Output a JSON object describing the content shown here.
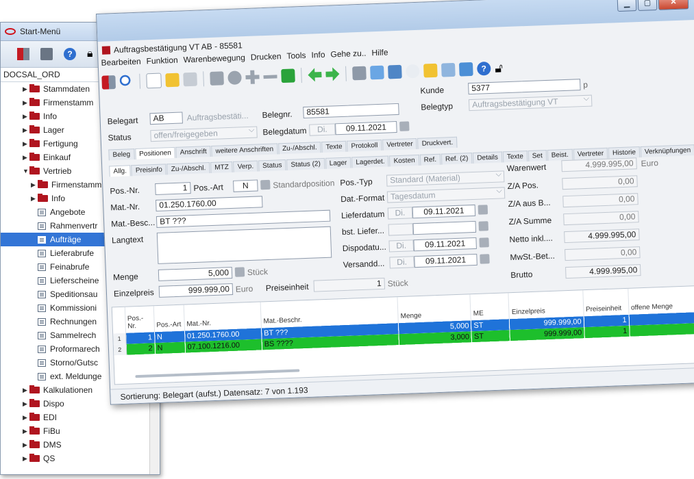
{
  "startmenu": {
    "title": "Start-Menü",
    "database": "DOCSAL_ORD",
    "tree": [
      {
        "label": "Stammdaten",
        "type": "folder",
        "level": 1,
        "expanded": false
      },
      {
        "label": "Firmenstamm",
        "type": "folder",
        "level": 1,
        "expanded": false
      },
      {
        "label": "Info",
        "type": "folder",
        "level": 1,
        "expanded": false
      },
      {
        "label": "Lager",
        "type": "folder",
        "level": 1,
        "expanded": false
      },
      {
        "label": "Fertigung",
        "type": "folder",
        "level": 1,
        "expanded": false
      },
      {
        "label": "Einkauf",
        "type": "folder",
        "level": 1,
        "expanded": false
      },
      {
        "label": "Vertrieb",
        "type": "folder",
        "level": 1,
        "expanded": true
      },
      {
        "label": "Firmenstamm",
        "type": "folder",
        "level": 2,
        "expanded": false
      },
      {
        "label": "Info",
        "type": "folder",
        "level": 2,
        "expanded": false
      },
      {
        "label": "Angebote",
        "type": "doc",
        "level": 2
      },
      {
        "label": "Rahmenvertr",
        "type": "doc",
        "level": 2
      },
      {
        "label": "Aufträge",
        "type": "doc",
        "level": 2,
        "selected": true
      },
      {
        "label": "Lieferabrufe",
        "type": "doc",
        "level": 2
      },
      {
        "label": "Feinabrufe",
        "type": "doc",
        "level": 2
      },
      {
        "label": "Lieferscheine",
        "type": "doc",
        "level": 2
      },
      {
        "label": "Speditionsau",
        "type": "doc",
        "level": 2
      },
      {
        "label": "Kommissioni",
        "type": "doc",
        "level": 2
      },
      {
        "label": "Rechnungen",
        "type": "doc",
        "level": 2
      },
      {
        "label": "Sammelrech",
        "type": "doc",
        "level": 2
      },
      {
        "label": "Proformarech",
        "type": "doc",
        "level": 2
      },
      {
        "label": "Storno/Gutsc",
        "type": "doc",
        "level": 2
      },
      {
        "label": "ext. Meldunge",
        "type": "doc",
        "level": 2
      },
      {
        "label": "Kalkulationen",
        "type": "folder",
        "level": 1,
        "expanded": false
      },
      {
        "label": "Dispo",
        "type": "folder",
        "level": 1,
        "expanded": false
      },
      {
        "label": "EDI",
        "type": "folder",
        "level": 1,
        "expanded": false
      },
      {
        "label": "FiBu",
        "type": "folder",
        "level": 1,
        "expanded": false
      },
      {
        "label": "DMS",
        "type": "folder",
        "level": 1,
        "expanded": false
      },
      {
        "label": "QS",
        "type": "folder",
        "level": 1,
        "expanded": false
      }
    ]
  },
  "window": {
    "title": "Auftragsbestätigung VT AB - 85581",
    "menu": [
      "Bearbeiten",
      "Funktion",
      "Warenbewegung",
      "Drucken",
      "Tools",
      "Info",
      "Gehe zu..",
      "Hilfe"
    ]
  },
  "header": {
    "kunde_label": "Kunde",
    "kunde_value": "5377",
    "kunde_suffix": "p",
    "belegart_label": "Belegart",
    "belegart_code": "AB",
    "belegart_text": "Auftragsbestäti...",
    "belegnr_label": "Belegnr.",
    "belegnr_value": "85581",
    "belegtyp_label": "Belegtyp",
    "belegtyp_value": "Auftragsbestätigung VT",
    "status_label": "Status",
    "status_value": "offen/freigegeben",
    "belegdatum_label": "Belegdatum",
    "belegdatum_day": "Di.",
    "belegdatum_value": "09.11.2021"
  },
  "tabs_main": [
    "Beleg",
    "Positionen",
    "Anschrift",
    "weitere Anschriften",
    "Zu-/Abschl.",
    "Texte",
    "Protokoll",
    "Vertreter",
    "Druckvert."
  ],
  "tabs_main_active": "Positionen",
  "tabs_pos": [
    "Allg.",
    "Preisinfo",
    "Zu-/Abschl.",
    "MTZ",
    "Verp.",
    "Status",
    "Status (2)",
    "Lager",
    "Lagerdet.",
    "Kosten",
    "Ref.",
    "Ref. (2)",
    "Details",
    "Texte",
    "Set",
    "Beist.",
    "Vertreter",
    "Historie",
    "Verknüpfungen"
  ],
  "tabs_pos_active": "Allg.",
  "position": {
    "posnr_label": "Pos.-Nr.",
    "posnr_value": "1",
    "posart_label": "Pos.-Art",
    "posart_value": "N",
    "posart_text": "Standardposition",
    "matnr_label": "Mat.-Nr.",
    "matnr_value": "01.250.1760.00",
    "matbesc_label": "Mat.-Besc...",
    "matbesc_value": "BT ???",
    "langtext_label": "Langtext",
    "menge_label": "Menge",
    "menge_value": "5,000",
    "menge_unit": "Stück",
    "einzelpreis_label": "Einzelpreis",
    "einzelpreis_value": "999.999,00",
    "einzelpreis_unit": "Euro",
    "preiseinheit_label": "Preiseinheit",
    "preiseinheit_value": "1",
    "preiseinheit_unit": "Stück",
    "postyp_label": "Pos.-Typ",
    "postyp_value": "Standard (Material)",
    "datformat_label": "Dat.-Format",
    "datformat_value": "Tagesdatum",
    "lieferdatum_label": "Lieferdatum",
    "lieferdatum_day": "Di.",
    "lieferdatum_value": "09.11.2021",
    "bstliefer_label": "bst. Liefer...",
    "dispodatum_label": "Dispodatu...",
    "dispodatum_day": "Di.",
    "dispodatum_value": "09.11.2021",
    "versanddatum_label": "Versandd...",
    "versanddatum_day": "Di.",
    "versanddatum_value": "09.11.2021"
  },
  "totals": {
    "warenwert_label": "Warenwert",
    "warenwert_value": "4.999.995,00",
    "warenwert_unit": "Euro",
    "zapos_label": "Z/A Pos.",
    "zapos_value": "0,00",
    "zaausb_label": "Z/A aus B...",
    "zaausb_value": "0,00",
    "zasumme_label": "Z/A Summe",
    "zasumme_value": "0,00",
    "netto_label": "Netto inkl....",
    "netto_value": "4.999.995,00",
    "mwst_label": "MwSt.-Bet...",
    "mwst_value": "0,00",
    "brutto_label": "Brutto",
    "brutto_value": "4.999.995,00"
  },
  "grid": {
    "columns": [
      "Pos.-Nr.",
      "Pos.-Art",
      "Mat.-Nr.",
      "Mat.-Beschr.",
      "Menge",
      "ME",
      "Einzelpreis",
      "Preiseinheit",
      "offene Menge"
    ],
    "rows": [
      {
        "rownum": "1",
        "posnr": "1",
        "posart": "N",
        "matnr": "01.250.1760.00",
        "beschr": "BT ???",
        "menge": "5,000",
        "me": "ST",
        "einzelpreis": "999.999,00",
        "preiseinheit": "1",
        "offen": ""
      },
      {
        "rownum": "2",
        "posnr": "2",
        "posart": "N",
        "matnr": "07.100.1216.00",
        "beschr": "BS ????",
        "menge": "3,000",
        "me": "ST",
        "einzelpreis": "999.999,00",
        "preiseinheit": "1",
        "offen": ""
      }
    ]
  },
  "status": {
    "text": "Sortierung: Belegart (aufst.) Datensatz: 7 von 1.193"
  },
  "colors": {
    "selected_row": "#1f73d9",
    "green_row": "#1dbf2c",
    "brand_red": "#b0151f"
  }
}
